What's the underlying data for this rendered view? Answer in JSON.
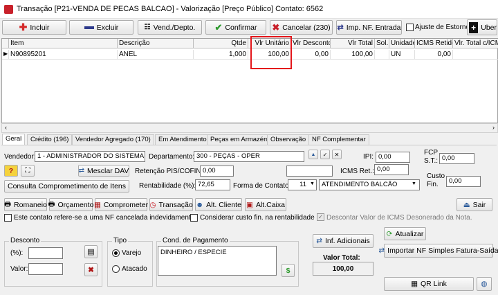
{
  "window": {
    "title": "Transação [P21-VENDA DE PECAS BALCAO] - Valorização [Preço Público]  Contato: 6562"
  },
  "toolbar": {
    "incluir": "Incluir",
    "excluir": "Excluir",
    "vend_depto": "Vend./Depto.",
    "confirmar": "Confirmar",
    "cancelar": "Cancelar (230)",
    "imp_nf": "Imp. NF. Entrada",
    "ajuste": "Ajuste de Estorno",
    "uber": "Uber"
  },
  "grid": {
    "columns": [
      "Item",
      "Descrição",
      "Qtde",
      "Vlr Unitário",
      "Vlr Desconto",
      "Vlr Total",
      "Sol.",
      "Unidade",
      "ICMS Retido",
      "Vlr. Total c/ICMS"
    ],
    "rows": [
      {
        "item": "N90895201",
        "descricao": "ANEL",
        "qtde": "1,000",
        "vlr_unitario": "100,00",
        "vlr_desconto": "0,00",
        "vlr_total": "100,00",
        "sol": "",
        "unidade": "UN",
        "icms_retido": "0,00",
        "vlr_total_icms": ""
      }
    ]
  },
  "tabs": [
    "Geral",
    "Crédito (196)",
    "Vendedor Agregado (170)",
    "Em Atendimento",
    "Peças em Armazém",
    "Observação",
    "NF Complementar"
  ],
  "geral": {
    "vendedor_label": "Vendedor:",
    "vendedor_value": "1 - ADMINISTRADOR DO SISTEMA",
    "departamento_label": "Departamento:",
    "departamento_value": "300 - PEÇAS - OPER",
    "ipi_label": "IPI:",
    "ipi_value": "0,00",
    "fcp_label": "FCP",
    "fcp_st_label": "S.T.:",
    "fcp_value": "0,00",
    "mesclar_dav": "Mesclar DAV",
    "retencao_label": "Retenção PIS/COFINS:",
    "retencao_value": "0,00",
    "icms_ret_label": "ICMS Ret.:",
    "icms_ret_value": "0,00",
    "custo_label": "Custo",
    "custo_fin_label": "Fin.",
    "custo_value": "0,00",
    "consulta_btn": "Consulta Comprometimento de Itens",
    "rentabilidade_label": "Rentabilidade (%):",
    "rentabilidade_value": "72,65",
    "forma_contato_label": "Forma de Contato:",
    "forma_contato_code": "11",
    "forma_contato_value": "ATENDIMENTO BALCÃO"
  },
  "actions": {
    "romaneio": "Romaneio",
    "orcamento": "Orçamento",
    "comprometer": "Comprometer",
    "transacao": "Transação",
    "alt_cliente": "Alt. Cliente",
    "alt_caixa": "Alt.Caixa",
    "sair": "Sair"
  },
  "checks": {
    "nf_cancelada": "Este contato refere-se a uma NF cancelada indevidamente",
    "custo_fin": "Considerar custo fin. na rentabilidade",
    "descontar_icms": "Descontar Valor de ICMS Desonerado da Nota."
  },
  "desconto": {
    "title": "Desconto",
    "pct_label": "(%):",
    "pct_value": "",
    "valor_label": "Valor:",
    "valor_value": ""
  },
  "tipo": {
    "title": "Tipo",
    "varejo": "Varejo",
    "atacado": "Atacado"
  },
  "pagamento": {
    "title": "Cond. de Pagamento",
    "value": "DINHEIRO / ESPECIE"
  },
  "right": {
    "inf_adicionais": "Inf. Adicionais",
    "atualizar": "Atualizar",
    "importar_nf": "Importar NF Simples Fatura-Saída",
    "valor_total_label": "Valor Total:",
    "valor_total_value": "100,00",
    "qr_link": "QR Link"
  },
  "colors": {
    "highlight": "#e3151a",
    "incluir": "#d42a2a",
    "excluir": "#2e3a8c",
    "confirmar": "#2e9a2e",
    "cancelar": "#c8202a"
  }
}
